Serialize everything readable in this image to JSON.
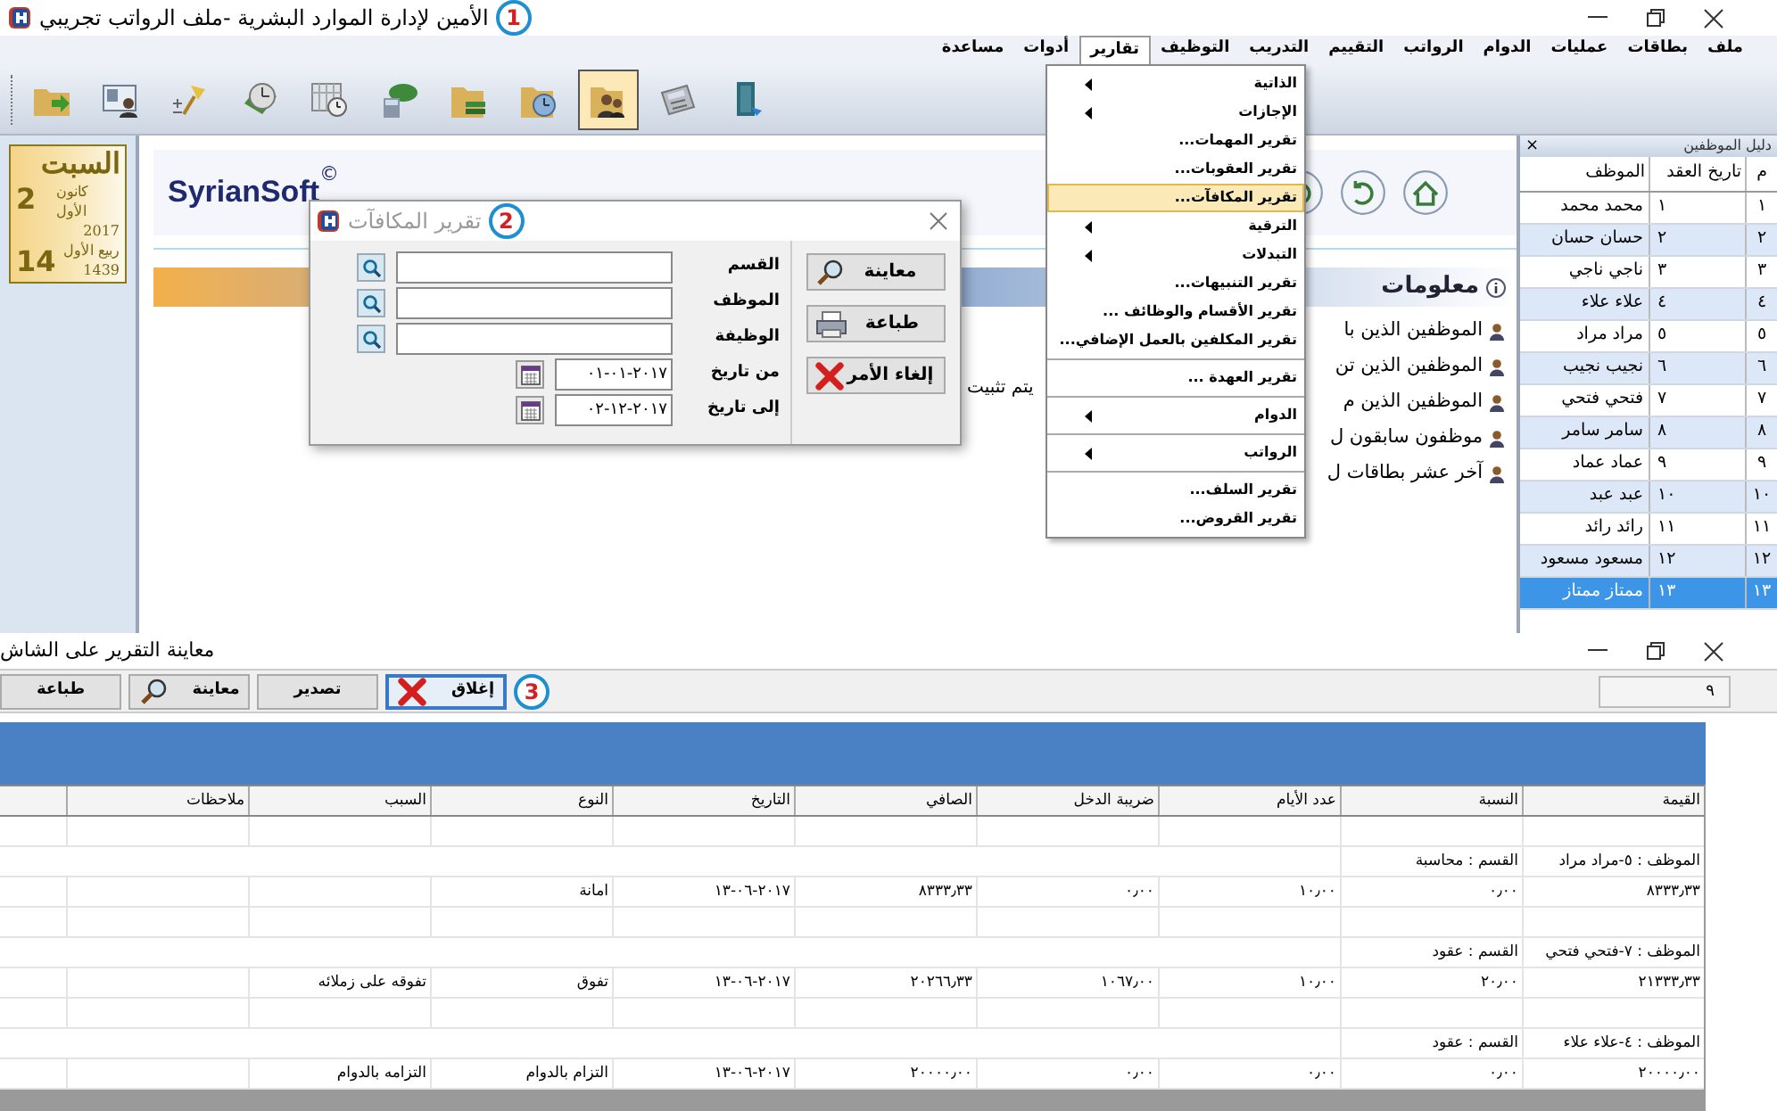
{
  "window": {
    "title": "الأمين لإدارة الموارد البشرية -ملف الرواتب تجريبي",
    "badge": "1"
  },
  "menu": [
    {
      "label": "ملف",
      "selected": false
    },
    {
      "label": "بطاقات",
      "selected": false
    },
    {
      "label": "عمليات",
      "selected": false
    },
    {
      "label": "الدوام",
      "selected": false
    },
    {
      "label": "الرواتب",
      "selected": false
    },
    {
      "label": "التقييم",
      "selected": false
    },
    {
      "label": "التدريب",
      "selected": false
    },
    {
      "label": "التوظيف",
      "selected": false
    },
    {
      "label": "تقارير",
      "selected": true
    },
    {
      "label": "أدوات",
      "selected": false
    },
    {
      "label": "مساعدة",
      "selected": false
    }
  ],
  "toolbar": [
    {
      "kind": "folder-arrow",
      "pressed": false
    },
    {
      "kind": "id-card",
      "pressed": false
    },
    {
      "kind": "pin",
      "pressed": false
    },
    {
      "kind": "clock-book",
      "pressed": false
    },
    {
      "kind": "calendar-clock",
      "pressed": false
    },
    {
      "kind": "money",
      "pressed": false
    },
    {
      "kind": "folder-books",
      "pressed": false
    },
    {
      "kind": "folder-clock",
      "pressed": false
    },
    {
      "kind": "folder-people",
      "pressed": true
    },
    {
      "kind": "calculator",
      "pressed": false
    },
    {
      "kind": "door",
      "pressed": false
    }
  ],
  "calendar": {
    "weekday": "السبت",
    "day": "2",
    "month": "كانون الأول",
    "year": "2017",
    "hijri_day": "14",
    "hijri_month": "ربيع الأول",
    "hijri_year": "1439"
  },
  "logo": {
    "name": "SyrianSoft",
    "mark": "©"
  },
  "info": {
    "title": "معلومات",
    "items": [
      "الموظفين الذين با",
      "الموظفين الذين تن",
      "الموظفين الذين م",
      "موظفون سابقون ل",
      "آخر عشر بطاقات ل"
    ],
    "note": "يتم تثبيت"
  },
  "employee_panel": {
    "title": "دليل الموظفين",
    "close": "×",
    "columns": [
      "م",
      "تاريخ العقد",
      "الموظف"
    ],
    "rows": [
      {
        "index": "١",
        "date": "١",
        "name": "محمد محمد",
        "selected": false
      },
      {
        "index": "٢",
        "date": "٢",
        "name": "حسان حسان",
        "selected": false
      },
      {
        "index": "٣",
        "date": "٣",
        "name": "ناجي ناجي",
        "selected": false
      },
      {
        "index": "٤",
        "date": "٤",
        "name": "علاء علاء",
        "selected": false
      },
      {
        "index": "٥",
        "date": "٥",
        "name": "مراد مراد",
        "selected": false
      },
      {
        "index": "٦",
        "date": "٦",
        "name": "نجيب نجيب",
        "selected": false
      },
      {
        "index": "٧",
        "date": "٧",
        "name": "فتحي فتحي",
        "selected": false
      },
      {
        "index": "٨",
        "date": "٨",
        "name": "سامر سامر",
        "selected": false
      },
      {
        "index": "٩",
        "date": "٩",
        "name": "عماد عماد",
        "selected": false
      },
      {
        "index": "١٠",
        "date": "١٠",
        "name": "عبد عبد",
        "selected": false
      },
      {
        "index": "١١",
        "date": "١١",
        "name": "رائد رائد",
        "selected": false
      },
      {
        "index": "١٢",
        "date": "١٢",
        "name": "مسعود مسعود",
        "selected": false
      },
      {
        "index": "١٣",
        "date": "١٣",
        "name": "ممتاز ممتاز",
        "selected": true
      }
    ]
  },
  "reports_menu": [
    {
      "kind": "submenu",
      "label": "الذاتية",
      "selected": false
    },
    {
      "kind": "submenu",
      "label": "الإجازات",
      "selected": false
    },
    {
      "kind": "item",
      "label": "تقرير المهمات...",
      "selected": false
    },
    {
      "kind": "item",
      "label": "تقرير العقوبات...",
      "selected": false
    },
    {
      "kind": "item",
      "label": "تقرير المكافآت...",
      "selected": true
    },
    {
      "kind": "submenu",
      "label": "الترقية",
      "selected": false
    },
    {
      "kind": "submenu",
      "label": "التبدلات",
      "selected": false
    },
    {
      "kind": "item",
      "label": "تقرير التنبيهات...",
      "selected": false
    },
    {
      "kind": "item",
      "label": "تقرير الأقسام والوظائف ...",
      "selected": false
    },
    {
      "kind": "item",
      "label": "تقرير المكلفين بالعمل الإضافي...",
      "selected": false
    },
    {
      "kind": "separator"
    },
    {
      "kind": "item",
      "label": "تقرير العهدة ...",
      "selected": false
    },
    {
      "kind": "separator"
    },
    {
      "kind": "submenu",
      "label": "الدوام",
      "selected": false
    },
    {
      "kind": "separator"
    },
    {
      "kind": "submenu",
      "label": "الرواتب",
      "selected": false
    },
    {
      "kind": "separator"
    },
    {
      "kind": "item",
      "label": "تقرير السلف...",
      "selected": false
    },
    {
      "kind": "item",
      "label": "تقرير القروض...",
      "selected": false
    }
  ],
  "dialog": {
    "title": "تقرير المكافآت",
    "badge": "2",
    "fields": [
      {
        "kind": "lookup",
        "label": "القسم"
      },
      {
        "kind": "lookup",
        "label": "الموظف"
      },
      {
        "kind": "lookup",
        "label": "الوظيفة"
      },
      {
        "kind": "date",
        "label": "من تاريخ",
        "value": "٠١-٠١-٢٠١٧"
      },
      {
        "kind": "date",
        "label": "إلى تاريخ",
        "value": "٠٢-١٢-٢٠١٧"
      }
    ],
    "buttons": [
      {
        "kind": "preview",
        "label": "معاينة"
      },
      {
        "kind": "print",
        "label": "طباعة"
      },
      {
        "kind": "cancel",
        "label": "إلغاء الأمر"
      }
    ]
  },
  "report_window": {
    "title": "معاينة التقرير على الشاش",
    "badge": "3",
    "page": "٩",
    "buttons": [
      {
        "kind": "close",
        "label": "إغلاق",
        "focused": true
      },
      {
        "kind": "plain",
        "label": "تصدير",
        "focused": false
      },
      {
        "kind": "preview",
        "label": "معاينة",
        "focused": false
      },
      {
        "kind": "plain",
        "label": "طباعة",
        "focused": false
      }
    ],
    "columns": [
      "القيمة",
      "النسبة",
      "عدد الأيام",
      "ضريبة الدخل",
      "الصافي",
      "التاريخ",
      "النوع",
      "السبب",
      "ملاحظات"
    ],
    "rows": [
      {
        "kind": "blank"
      },
      {
        "kind": "group",
        "employee": "الموظف : ٥-مراد مراد",
        "department": "القسم : محاسبة"
      },
      {
        "kind": "data",
        "cells": [
          "٨٣٣٣٫٣٣",
          "٠٫٠٠",
          "١٠٫٠٠",
          "٠٫٠٠",
          "٨٣٣٣٫٣٣",
          "١٣-٠٦-٢٠١٧",
          "امانة"
        ]
      },
      {
        "kind": "blank"
      },
      {
        "kind": "group",
        "employee": "الموظف : ٧-فتحي فتحي",
        "department": "القسم : عقود"
      },
      {
        "kind": "data",
        "cells": [
          "٢١٣٣٣٫٣٣",
          "٢٠٫٠٠",
          "١٠٫٠٠",
          "١٠٦٧٫٠٠",
          "٢٠٢٦٦٫٣٣",
          "١٣-٠٦-٢٠١٧",
          "تفوق",
          "تفوقه على زملائه"
        ]
      },
      {
        "kind": "blank"
      },
      {
        "kind": "group",
        "employee": "الموظف : ٤-علاء علاء",
        "department": "القسم : عقود"
      },
      {
        "kind": "data",
        "cells": [
          "٢٠٠٠٠٫٠٠",
          "٠٫٠٠",
          "٠٫٠٠",
          "٠٫٠٠",
          "٢٠٠٠٠٫٠٠",
          "١٣-٠٦-٢٠١٧",
          "التزام بالدوام",
          "التزامه بالدوام"
        ]
      }
    ]
  }
}
